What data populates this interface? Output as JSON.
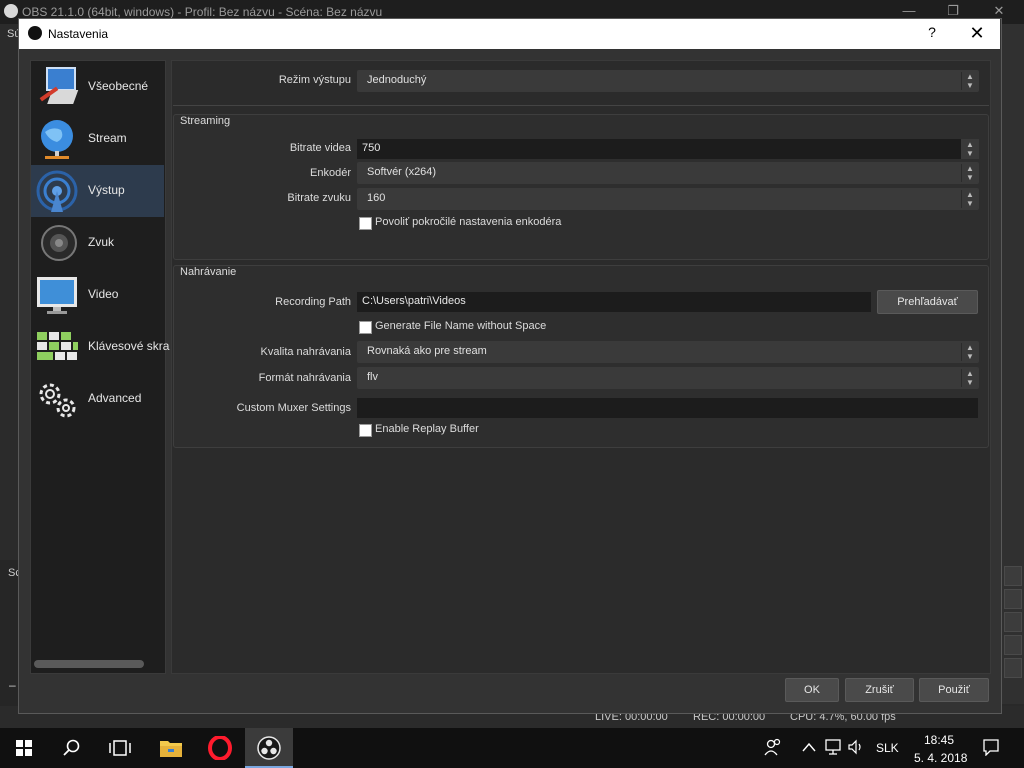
{
  "main_window": {
    "title": "OBS 21.1.0 (64bit, windows) - Profil: Bez názvu - Scéna: Bez názvu",
    "left_fragment_top": "Sú",
    "left_fragment_mid": "Sc",
    "status": {
      "live": "LIVE: 00:00:00",
      "rec": "REC: 00:00:00",
      "cpu": "CPU: 4.7%, 60.00 fps"
    }
  },
  "dialog": {
    "title": "Nastavenia",
    "help": "?",
    "close": "✕"
  },
  "sidebar": {
    "items": [
      {
        "label": "Všeobecné",
        "icon": "general-icon"
      },
      {
        "label": "Stream",
        "icon": "stream-globe-icon"
      },
      {
        "label": "Výstup",
        "icon": "output-broadcast-icon",
        "active": true
      },
      {
        "label": "Zvuk",
        "icon": "speaker-icon"
      },
      {
        "label": "Video",
        "icon": "monitor-icon"
      },
      {
        "label": "Klávesové skra",
        "icon": "keyboard-icon"
      },
      {
        "label": "Advanced",
        "icon": "gears-icon"
      }
    ]
  },
  "output": {
    "mode_label": "Režim výstupu",
    "mode_value": "Jednoduchý",
    "streaming": {
      "title": "Streaming",
      "video_bitrate_label": "Bitrate videa",
      "video_bitrate_value": "750",
      "encoder_label": "Enkodér",
      "encoder_value": "Softvér (x264)",
      "audio_bitrate_label": "Bitrate zvuku",
      "audio_bitrate_value": "160",
      "advanced_encoder_label": "Povoliť pokročilé nastavenia enkodéra"
    },
    "recording": {
      "title": "Nahrávanie",
      "path_label": "Recording Path",
      "path_value": "C:\\Users\\patri\\Videos",
      "browse_label": "Prehľadávať",
      "no_space_label": "Generate File Name without Space",
      "quality_label": "Kvalita nahrávania",
      "quality_value": "Rovnaká ako pre stream",
      "format_label": "Formát nahrávania",
      "format_value": "flv",
      "muxer_label": "Custom Muxer Settings",
      "muxer_value": "",
      "replay_label": "Enable Replay Buffer"
    }
  },
  "buttons": {
    "ok": "OK",
    "cancel": "Zrušiť",
    "apply": "Použiť"
  },
  "taskbar": {
    "language": "SLK",
    "time": "18:45",
    "date": "5. 4. 2018"
  }
}
